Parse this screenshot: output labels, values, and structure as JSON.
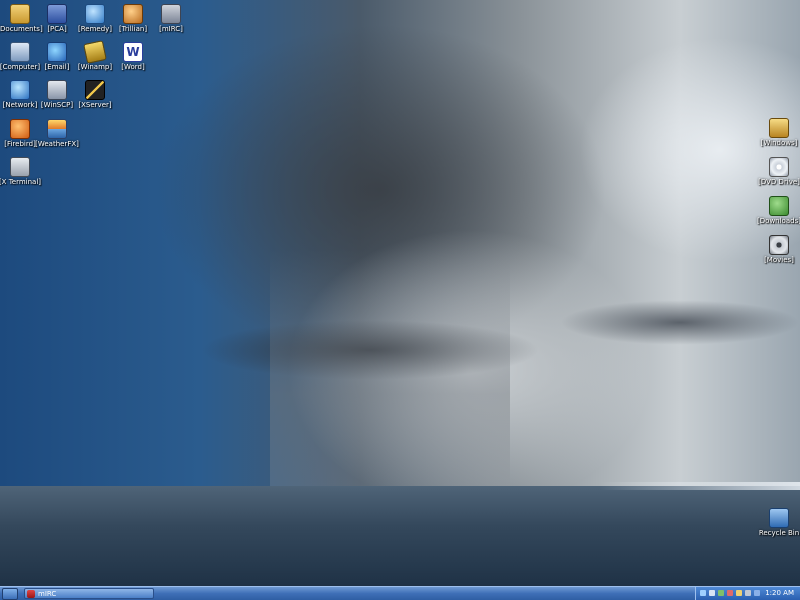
{
  "desktop": {
    "icons_left": [
      {
        "label": "[Documents]",
        "icon": "folder-documents-icon"
      },
      {
        "label": "[PCA]",
        "icon": "pca-icon"
      },
      {
        "label": "[Remedy]",
        "icon": "remedy-icon"
      },
      {
        "label": "[Trillian]",
        "icon": "trillian-icon"
      },
      {
        "label": "[mIRC]",
        "icon": "mirc-icon"
      },
      {
        "label": "[Computer]",
        "icon": "computer-icon"
      },
      {
        "label": "[Email]",
        "icon": "email-icon"
      },
      {
        "label": "[Winamp]",
        "icon": "winamp-icon"
      },
      {
        "label": "[Word]",
        "icon": "word-icon"
      },
      {
        "label": "[Network]",
        "icon": "network-icon"
      },
      {
        "label": "[WinSCP]",
        "icon": "winscp-icon"
      },
      {
        "label": "[XServer]",
        "icon": "xserver-icon"
      },
      {
        "label": "[Firebird]",
        "icon": "firebird-icon"
      },
      {
        "label": "[WeatherFX]",
        "icon": "weatherfx-icon"
      },
      {
        "label": "[X Terminal]",
        "icon": "terminal-icon"
      }
    ],
    "icons_right": [
      {
        "label": "[Windows]",
        "icon": "windows-folder-icon"
      },
      {
        "label": "[DVD Drive]",
        "icon": "dvd-drive-icon"
      },
      {
        "label": "[Downloads]",
        "icon": "downloads-icon"
      },
      {
        "label": "[Movies]",
        "icon": "movies-icon"
      },
      {
        "label": "Recycle Bin",
        "icon": "recycle-bin-icon"
      }
    ]
  },
  "taskbar": {
    "task": {
      "label": "mIRC",
      "icon": "mirc-task-icon"
    },
    "clock": "1:20 AM",
    "accent": "#3e6fb7"
  }
}
